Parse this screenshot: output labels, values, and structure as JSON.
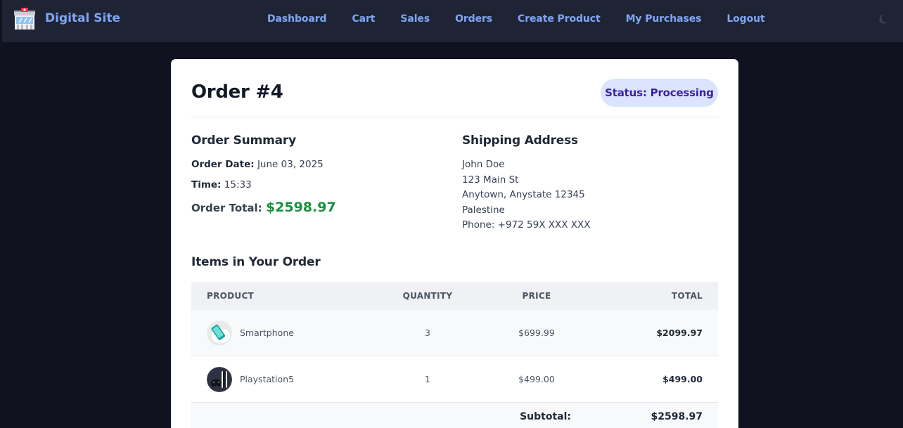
{
  "app": {
    "name": "Digital Site"
  },
  "nav": {
    "items": [
      "Dashboard",
      "Cart",
      "Sales",
      "Orders",
      "Create Product",
      "My Purchases",
      "Logout"
    ]
  },
  "theme": {
    "toggle_icon": "moon-icon"
  },
  "order": {
    "title": "Order #4",
    "status": "Status: Processing",
    "summary": {
      "heading": "Order Summary",
      "date_label": "Order Date:",
      "date_value": "June 03, 2025",
      "time_label": "Time:",
      "time_value": "15:33",
      "total_label": "Order Total:",
      "total_value": "$2598.97"
    },
    "shipping": {
      "heading": "Shipping Address",
      "lines": [
        "John Doe",
        "123 Main St",
        "Anytown, Anystate 12345",
        "Palestine",
        "Phone: +972 59X XXX XXX"
      ]
    },
    "items": {
      "heading": "Items in Your Order",
      "columns": [
        "PRODUCT",
        "QUANTITY",
        "PRICE",
        "TOTAL"
      ],
      "rows": [
        {
          "product": "Smartphone",
          "quantity": "3",
          "price": "$699.99",
          "total": "$2099.97"
        },
        {
          "product": "Playstation5",
          "quantity": "1",
          "price": "$499.00",
          "total": "$499.00"
        }
      ],
      "subtotal_label": "Subtotal:",
      "subtotal_value": "$2598.97"
    }
  },
  "colors": {
    "background": "#10121f",
    "topbar": "#1f2434",
    "nav_link": "#7ea6f5",
    "status_bg": "#dbe4fe",
    "status_text": "#3b23a8",
    "total_green": "#16923b"
  }
}
